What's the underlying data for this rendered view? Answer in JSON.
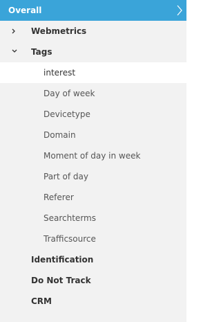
{
  "header": {
    "title": "Overall"
  },
  "nav": {
    "webmetrics": "Webmetrics",
    "tags": "Tags",
    "tags_children": [
      "interest",
      "Day of week",
      "Devicetype",
      "Domain",
      "Moment of day in week",
      "Part of day",
      "Referer",
      "Searchterms",
      "Trafficsource"
    ],
    "identification": "Identification",
    "do_not_track": "Do Not Track",
    "crm": "CRM"
  },
  "colors": {
    "header_bg": "#3aa4d9",
    "panel_bg": "#f2f2f2",
    "active_bg": "#ffffff"
  }
}
